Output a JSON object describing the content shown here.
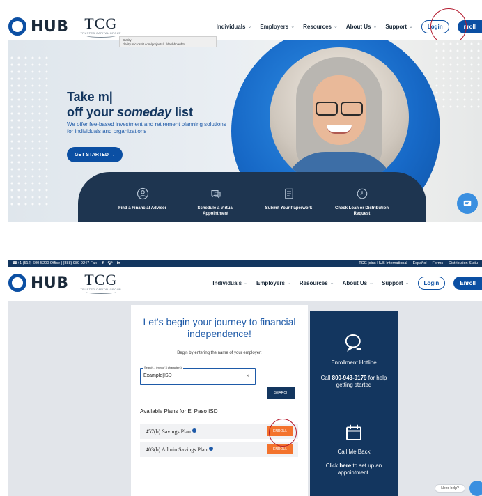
{
  "header": {
    "logo_hub": "HUB",
    "logo_tcg": "TCG",
    "logo_tcg_sub": "TRUSTED CAPITAL GROUP",
    "nav": [
      "Individuals",
      "Employers",
      "Resources",
      "About Us",
      "Support"
    ],
    "login": "Login",
    "enroll": "Enroll",
    "enroll_cropped": "nroll"
  },
  "tooltip": {
    "line1": "Clarity",
    "line2": "clarity.microsoft.com/projects/.../dashboard?d..."
  },
  "hero": {
    "title_line1": "Take m|",
    "title_line2_pre": "off your ",
    "title_line2_em": "someday",
    "title_line2_post": " list",
    "subtitle": "We offer fee-based investment and retirement planning solutions for individuals and organizations",
    "cta": "GET STARTED →"
  },
  "actions": [
    {
      "label": "Find a Financial Advisor",
      "icon": "advisor-icon"
    },
    {
      "label": "Schedule a Virtual Appointment",
      "icon": "calendar-chat-icon"
    },
    {
      "label": "Submit Your Paperwork",
      "icon": "document-icon"
    },
    {
      "label": "Check Loan or Distribution Request",
      "icon": "clock-icon"
    }
  ],
  "topbar": {
    "phone": "☎+1 (512) 600-5200 Office | (888) 989-9247 Fax",
    "social": [
      "f",
      "t",
      "in"
    ],
    "links": [
      "TCG joins HUB International",
      "Español",
      "Forms",
      "Distribution Statu"
    ]
  },
  "enroll_card": {
    "title": "Let's begin your journey to financial independence!",
    "lead": "Begin by entering the name of your employer:",
    "search_legend": "Search... (min of 3 characters)",
    "search_value": "Example|ISD",
    "clear": "×",
    "search_button": "SEARCH",
    "plans_heading": "Available Plans for El Paso ISD",
    "plans": [
      {
        "name": "457(b) Savings Plan",
        "button": "ENROLL"
      },
      {
        "name": "403(b) Admin Savings Plan",
        "button": "ENROLL"
      }
    ]
  },
  "side_panel": {
    "hotline_title": "Enrollment Hotline",
    "hotline_pre": "Call ",
    "hotline_number": "800-943-9179",
    "hotline_post": " for help getting started",
    "callback_title": "Call Me Back",
    "callback_pre": "Click ",
    "callback_link": "here",
    "callback_post": " to set up an appointment."
  },
  "help": {
    "need_help": "Need help?"
  },
  "colors": {
    "brand_blue": "#0b4fa3",
    "navy": "#13365f",
    "orange": "#f3732d",
    "annotation_red": "#b3192d"
  }
}
